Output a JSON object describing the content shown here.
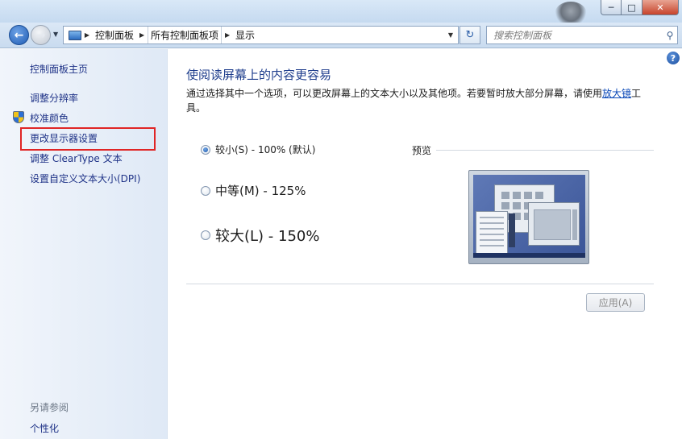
{
  "window": {
    "caption_minimize": "─",
    "caption_maximize": "□",
    "caption_close": "✕"
  },
  "nav": {
    "breadcrumbs": [
      "控制面板",
      "所有控制面板项",
      "显示"
    ],
    "search_placeholder": "搜索控制面板",
    "refresh_symbol": "↻"
  },
  "sidebar": {
    "home_link": "控制面板主页",
    "links": [
      "调整分辨率",
      "校准颜色",
      "更改显示器设置",
      "调整 ClearType 文本",
      "设置自定义文本大小(DPI)"
    ],
    "see_also_title": "另请参阅",
    "see_also_links": [
      "个性化"
    ]
  },
  "main": {
    "title": "使阅读屏幕上的内容更容易",
    "description_before_link": "通过选择其中一个选项，可以更改屏幕上的文本大小以及其他项。若要暂时放大部分屏幕，请使用",
    "description_link": "放大镜",
    "description_after_link": "工具。",
    "options": [
      {
        "label": "较小(S) - 100% (默认)",
        "checked": true
      },
      {
        "label": "中等(M) - 125%",
        "checked": false
      },
      {
        "label": "较大(L) - 150%",
        "checked": false
      }
    ],
    "preview_label": "预览",
    "apply_button": "应用(A)"
  },
  "colors": {
    "link": "#1e3287",
    "title": "#1e3d8c",
    "highlight_border": "#e02525",
    "sidebar_bg": "#e6eef8"
  }
}
